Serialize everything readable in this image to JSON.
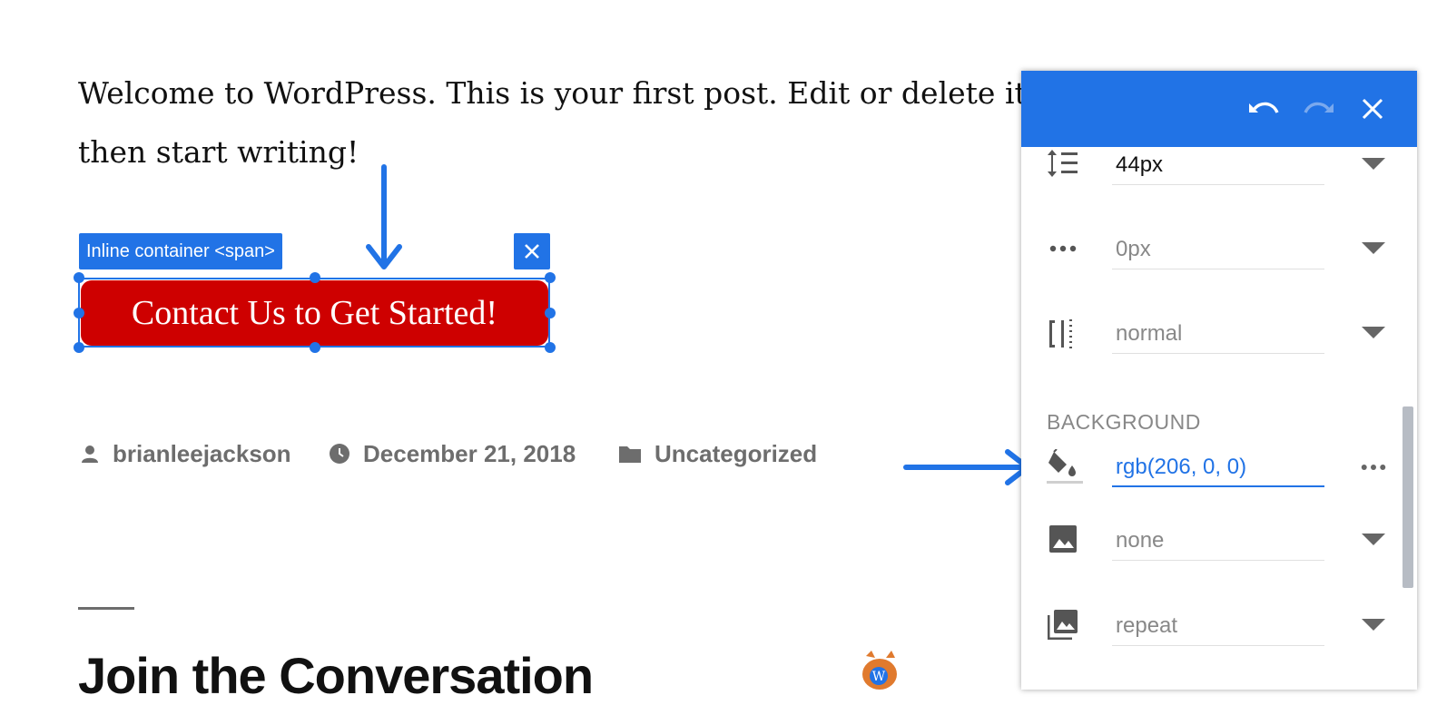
{
  "post": {
    "paragraph": "Welcome to WordPress. This is your first post. Edit or delete it, then start writing!"
  },
  "selection": {
    "label": "Inline container <span>",
    "button_text": "Contact Us to Get Started!",
    "button_color": "#ce0000"
  },
  "meta": {
    "author": "brianleejackson",
    "date": "December 21, 2018",
    "category": "Uncategorized"
  },
  "comments": {
    "heading": "Join the Conversation"
  },
  "panel": {
    "accent": "#2173e6",
    "rows": {
      "line_height": "44px",
      "letter_spacing": "0px",
      "word_spacing": "normal"
    },
    "background_section": "BACKGROUND",
    "background_color": "rgb(206, 0, 0)",
    "background_image": "none",
    "background_repeat": "repeat"
  },
  "icons": [
    "undo-icon",
    "redo-icon",
    "close-icon",
    "line-height-icon",
    "more-horiz-icon",
    "word-spacing-icon",
    "paint-bucket-icon",
    "image-icon",
    "image-stack-icon",
    "person-icon",
    "clock-icon",
    "folder-icon",
    "chevron-down-icon"
  ]
}
